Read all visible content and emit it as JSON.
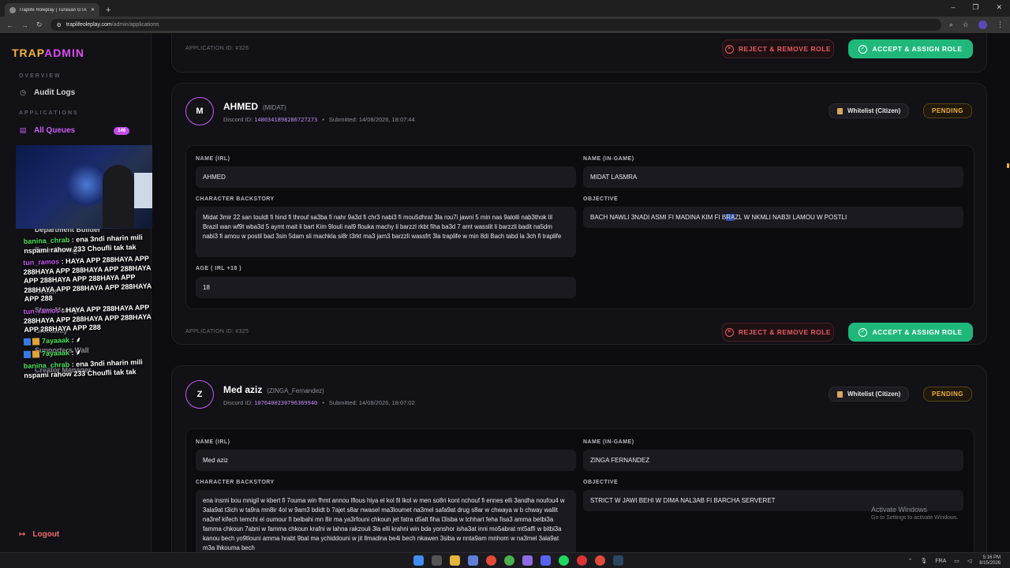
{
  "browser": {
    "tab_title": "Traplife Roleplay | Tunisian GTA",
    "new_tab": "+",
    "url_host": "traplifeoleplay.com",
    "url_path": "/admin/applications",
    "win_min": "–",
    "win_max": "❐",
    "win_close": "✕"
  },
  "sidebar": {
    "brand_a": "TRAP",
    "brand_b": "ADMIN",
    "section_overview": "OVERVIEW",
    "audit_logs": "Audit Logs",
    "section_applications": "APPLICATIONS",
    "all_queues": "All Queues",
    "queue_count": "146",
    "department_builder": "Department Builder",
    "team_manager": "Team Manage",
    "tun_ramos_overlap": "Roster",
    "store_manager": "Store Manage",
    "giveaway": "Giveaway",
    "supporters_wall": "Supporters Wall",
    "creator_manager": "Creator Manager",
    "logout": "Logout"
  },
  "chat": [
    {
      "user": "banina_chrab",
      "text": ": ena 3ndi nharin mili nspami rahow 233 Choufli tak tak",
      "color": "#4ee35c"
    },
    {
      "user": "tun_ramos",
      "text": ": HAYA APP 288HAYA APP 288HAYA APP 288HAYA APP 288HAYA APP 288HAYA APP 288HAYA APP 288HAYA APP 288HAYA APP 288HAYA APP 288",
      "color": "#c55af2"
    },
    {
      "user": "tun_ramos",
      "text": ": HAYA APP 288HAYA APP 288HAYA APP 288HAYA APP 288HAYA APP 288HAYA APP 288",
      "color": "#c55af2"
    },
    {
      "user": "7ayaaak",
      "text": ": ⸙",
      "color": "#4ee35c",
      "badges": true
    },
    {
      "user": "7ayaaak",
      "text": ": ⸙",
      "color": "#4ee35c",
      "badges": true
    },
    {
      "user": "banina_chrab",
      "text": ": ena 3ndi nharin mili nspami rahow 233 Choufli tak tak",
      "color": "#4ee35c"
    }
  ],
  "card_top": {
    "app_id": "APPLICATION ID: #326",
    "reject": "REJECT & REMOVE ROLE",
    "accept": "ACCEPT & ASSIGN ROLE"
  },
  "app1": {
    "avatar": "M",
    "name": "AHMED",
    "ig": "(MIDAT)",
    "discord_label": "Discord ID:",
    "discord_id": "1480341898286727273",
    "submitted": "Submitted: 14/08/2026, 18:07:44",
    "type": "Whitelist (Citizen)",
    "status": "PENDING",
    "label_name_irl": "NAME (IRL)",
    "name_irl": "AHMED",
    "label_name_ig": "NAME (IN-GAME)",
    "name_ig": "MIDAT LASMRA",
    "label_backstory": "CHARACTER BACKSTORY",
    "backstory": "Midat 3mir 22 san touldt fi hind fi throuf sa3ba fi nahr 9a3d fi chr3 nabi3 fi mou5dhrat 3la rou7i jawni 5 min nas 9alolli nab3thok lil Brazil wan wf9t wba3d 5 aymt mait li bart Kim 9louli nal9 flouka machy li barzzl rkbt fiha ba3d 7 amt wasslit li barzzli badit na5dm nabi3 fi amou w postil bad 3sin 5dam sli machkla si8r t3rkt ma3 jam3 barzzli wassfrt 3la traplife w min 8di Bach tabd la 3ch fi traplife",
    "label_objective": "OBJECTIVE",
    "objective_a": "BACH NAWLI 3NADI ASMI FI MADINA KIM FI B",
    "objective_hl": "RA",
    "objective_b": "ZL W NKMLI NAB3I LAMOU W  POSTLI",
    "label_age": "AGE ( IRL +18 )",
    "age": "18",
    "app_id": "APPLICATION ID: #325",
    "reject": "REJECT & REMOVE ROLE",
    "accept": "ACCEPT & ASSIGN ROLE"
  },
  "app2": {
    "avatar": "Z",
    "name": "Med aziz",
    "ig": "(ZINGA_Fernandez)",
    "discord_label": "Discord ID:",
    "discord_id": "1076400230796369940",
    "submitted": "Submitted: 14/08/2026, 18:07:02",
    "type": "Whitelist (Citizen)",
    "status": "PENDING",
    "label_name_irl": "NAME (IRL)",
    "name_irl": "Med aziz",
    "label_name_ig": "NAME (IN-GAME)",
    "name_ig": "ZINGA FERNANDEZ",
    "label_backstory": "CHARACTER BACKSTORY",
    "backstory": "ena insmi bou mnigil w kbert fi 7ouma win fhmt annou lflous hiya el kol fil lkol w men so8ri kont nchouf fi ennes elli 3andha noufou4 w 3ala9at t3ich w ta9ra mn8ir 4ol w 9am3 bdidt b 7ajet s8ar nwasel ma3loumet na3mel safa9at drug s8ar w chwaya w b chway wallit na3ref kifech temchi el oumour fi belbahi mn 8ir ma ya3rfouni chkoun jet fatra d5alt fiha l3isba w tchhart feha fisa3 amma betbi3a famma chkoun 7abni w famma chkoun krafni w lahna rakzouli 3la elli krahni win bda yonshor isha3at inni mo5abrat mt5affi w bitbi3a kanou bech yo9tlouni amma hrabt 9bal ma ychiddouni w jit llmadina be4i bech nkawen 3siba w nnta9am mnhom w na3mel 3ala9at m3a lhkouma bech",
    "label_objective": "OBJECTIVE",
    "objective": "STRICT W JAWI BEHI W DIMA NAL3AB FI BARCHA SERVERET"
  },
  "os": {
    "activate_title": "Activate Windows",
    "activate_sub": "Go to Settings to activate Windows.",
    "lang": "FRA",
    "time": "5:16 PM",
    "date": "8/15/2026"
  }
}
